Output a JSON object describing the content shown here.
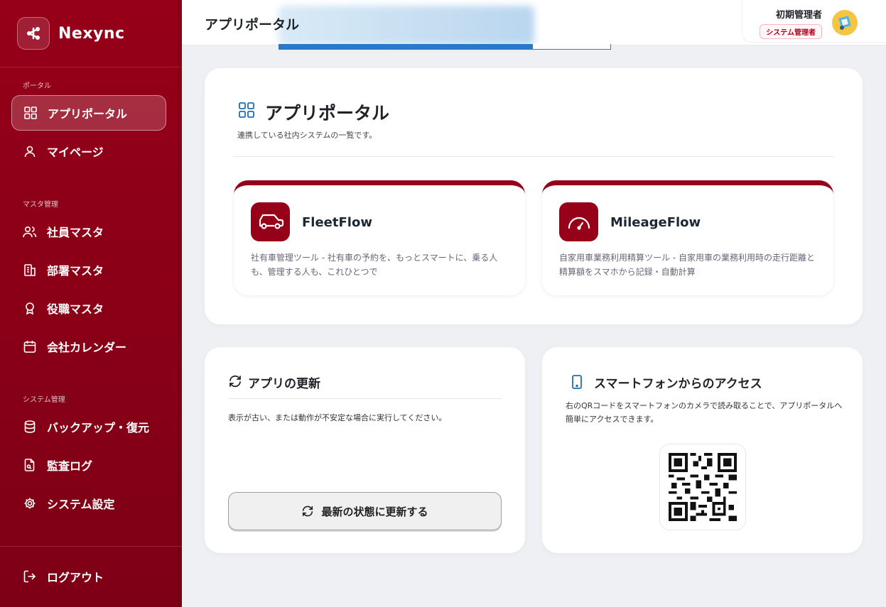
{
  "brand": {
    "name": "Nexync"
  },
  "sidebar": {
    "sections": [
      {
        "label": "ポータル"
      },
      {
        "label": "マスタ管理"
      },
      {
        "label": "システム管理"
      }
    ],
    "items": [
      {
        "label": "アプリポータル",
        "icon": "grid-icon",
        "active": true
      },
      {
        "label": "マイページ",
        "icon": "user-icon"
      },
      {
        "label": "社員マスタ",
        "icon": "users-icon"
      },
      {
        "label": "部署マスタ",
        "icon": "building-icon"
      },
      {
        "label": "役職マスタ",
        "icon": "award-icon"
      },
      {
        "label": "会社カレンダー",
        "icon": "calendar-icon"
      },
      {
        "label": "バックアップ・復元",
        "icon": "database-icon"
      },
      {
        "label": "監査ログ",
        "icon": "file-search-icon"
      },
      {
        "label": "システム設定",
        "icon": "gear-icon"
      }
    ],
    "logout": "ログアウト"
  },
  "header": {
    "title": "アプリポータル",
    "user_name": "初期管理者",
    "user_role": "システム管理者"
  },
  "portal": {
    "title": "アプリポータル",
    "subtitle": "連携している社内システムの一覧です。",
    "apps": [
      {
        "name": "FleetFlow",
        "icon": "car-icon",
        "description": "社有車管理ツール - 社有車の予約を、もっとスマートに、乗る人も、管理する人も、これひとつで"
      },
      {
        "name": "MileageFlow",
        "icon": "gauge-icon",
        "description": "自家用車業務利用精算ツール - 自家用車の業務利用時の走行距離と精算額をスマホから記録・自動計算"
      }
    ]
  },
  "update": {
    "title": "アプリの更新",
    "description": "表示が古い、または動作が不安定な場合に実行してください。",
    "button": "最新の状態に更新する"
  },
  "mobile": {
    "title": "スマートフォンからのアクセス",
    "description": "右のQRコードをスマートフォンのカメラで読み取ることで、アプリポータルへ簡単にアクセスできます。"
  },
  "colors": {
    "brand": "#960018",
    "accent_blue": "#1f6fb8"
  }
}
